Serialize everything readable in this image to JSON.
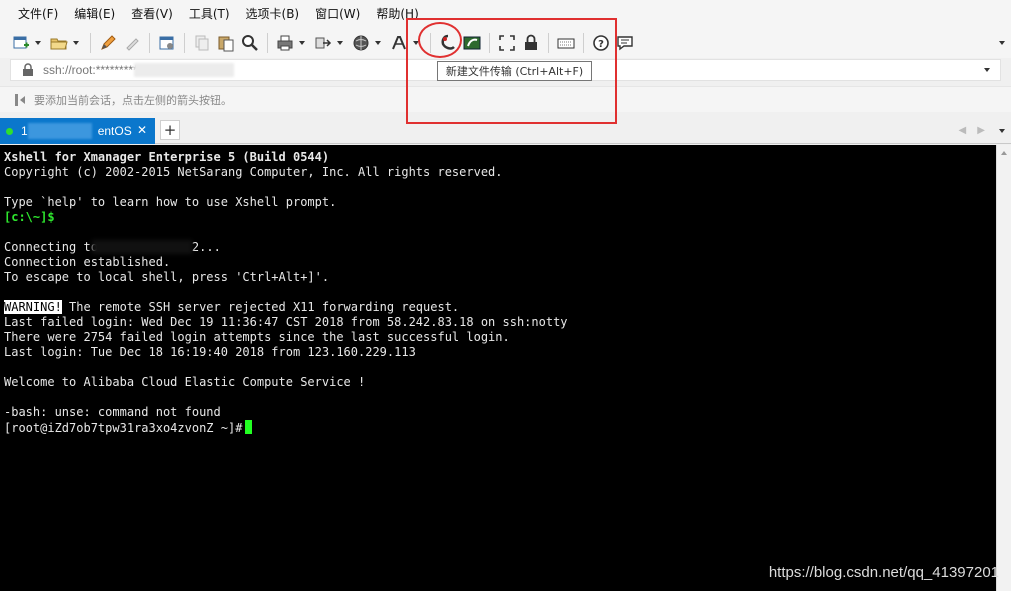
{
  "menu": {
    "items": [
      "文件(F)",
      "编辑(E)",
      "查看(V)",
      "工具(T)",
      "选项卡(B)",
      "窗口(W)",
      "帮助(H)"
    ]
  },
  "toolbar": {
    "icons": [
      "new-session-icon",
      "open-folder-icon",
      "edit-pencil-icon",
      "eraser-icon",
      "properties-icon",
      "copy-icon",
      "paste-icon",
      "find-icon",
      "print-icon",
      "transfer-icon",
      "globe-icon",
      "font-icon",
      "xftp-icon",
      "new-file-transfer-icon",
      "fullscreen-icon",
      "lock-icon",
      "keyboard-icon",
      "help-icon",
      "chat-icon"
    ]
  },
  "tooltip": {
    "text": "新建文件传输 (Ctrl+Alt+F)"
  },
  "address": {
    "url": "ssh://root:*********"
  },
  "hint": {
    "text": "要添加当前会话，点击左侧的箭头按钮。"
  },
  "tabs": [
    {
      "label": "1",
      "suffix": "entOS",
      "status_color": "#2ee02e",
      "active": true
    }
  ],
  "terminal": {
    "lines": [
      {
        "text": "Xshell for Xmanager Enterprise 5 (Build 0544)",
        "style": "bold"
      },
      {
        "text": "Copyright (c) 2002-2015 NetSarang Computer, Inc. All rights reserved.",
        "style": ""
      },
      {
        "text": "",
        "style": ""
      },
      {
        "text": "Type `help' to learn how to use Xshell prompt.",
        "style": ""
      },
      {
        "text": "[c:\\~]$",
        "style": "green"
      },
      {
        "text": "",
        "style": ""
      },
      {
        "text": "Connecting to",
        "style": "redacted",
        "tail": "2..."
      },
      {
        "text": "Connection established.",
        "style": ""
      },
      {
        "text": "To escape to local shell, press 'Ctrl+Alt+]'.",
        "style": ""
      },
      {
        "text": "",
        "style": ""
      },
      {
        "text": "WARNING!",
        "style": "warning",
        "tail": " The remote SSH server rejected X11 forwarding request."
      },
      {
        "text": "Last failed login: Wed Dec 19 11:36:47 CST 2018 from 58.242.83.18 on ssh:notty",
        "style": ""
      },
      {
        "text": "There were 2754 failed login attempts since the last successful login.",
        "style": ""
      },
      {
        "text": "Last login: Tue Dec 18 16:19:40 2018 from 123.160.229.113",
        "style": ""
      },
      {
        "text": "",
        "style": ""
      },
      {
        "text": "Welcome to Alibaba Cloud Elastic Compute Service !",
        "style": ""
      },
      {
        "text": "",
        "style": ""
      },
      {
        "text": "-bash: unse: command not found",
        "style": ""
      },
      {
        "text": "[root@iZd7ob7tpw31ra3xo4zvonZ ~]#",
        "style": "prompt"
      }
    ]
  },
  "watermark": "https://blog.csdn.net/qq_41397201",
  "colors": {
    "tab_active": "#0b77cc",
    "terminal_bg": "#000000",
    "cursor": "#22ff22",
    "highlight": "#e03030"
  }
}
